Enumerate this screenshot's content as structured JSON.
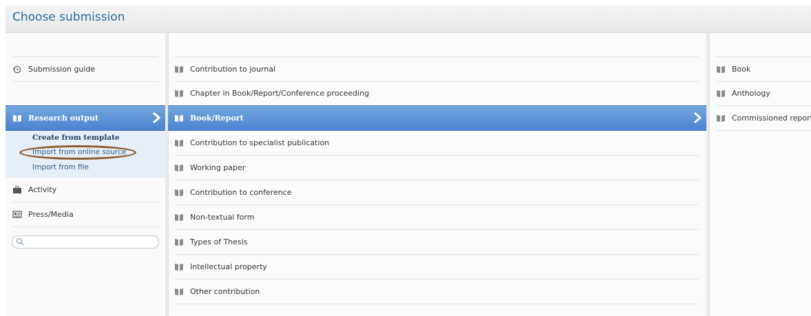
{
  "header": {
    "title": "Choose submission"
  },
  "left": {
    "guide_label": "Submission guide",
    "selected_label": "Research output",
    "sub_items": [
      "Create from template",
      "Import from online source",
      "Import from file"
    ],
    "activity_label": "Activity",
    "press_label": "Press/Media",
    "search": {
      "placeholder": "",
      "value": ""
    }
  },
  "middle": {
    "items": [
      "Contribution to journal",
      "Chapter in Book/Report/Conference proceeding",
      "Book/Report",
      "Contribution to specialist publication",
      "Working paper",
      "Contribution to conference",
      "Non-textual form",
      "Types of Thesis",
      "Intellectual property",
      "Other contribution"
    ],
    "selected_index": 2
  },
  "right": {
    "items": [
      "Book",
      "Anthology",
      "Commissioned report"
    ]
  },
  "colors": {
    "selected_bg": "#4a84cf",
    "title_color": "#2d6a93",
    "annotation_oval": "#8e5a2a",
    "icon_gray": "#8a8a8a"
  }
}
